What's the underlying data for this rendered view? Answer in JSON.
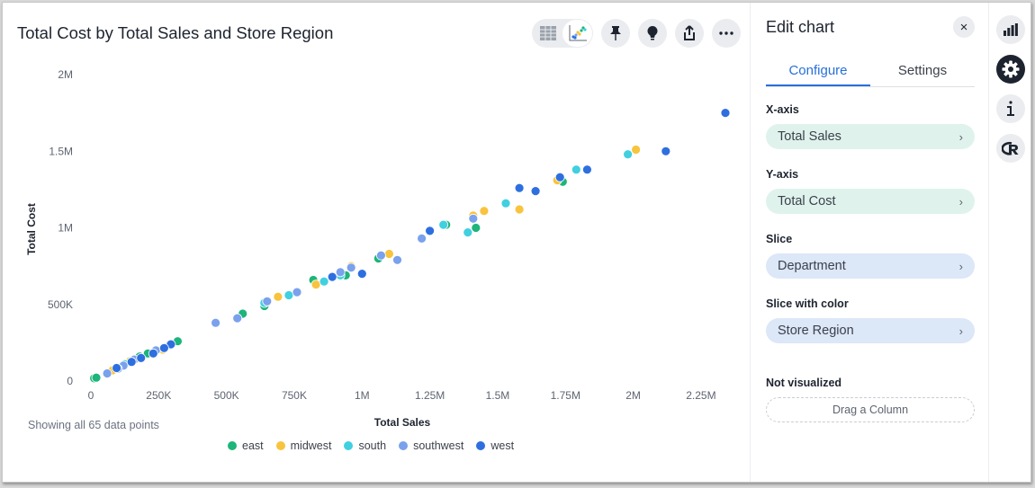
{
  "title": "Total Cost by Total Sales and Store Region",
  "toolbar": {
    "buttons": [
      {
        "name": "table-view-icon"
      },
      {
        "name": "chart-view-icon"
      },
      {
        "name": "pin-icon"
      },
      {
        "name": "lightbulb-icon"
      },
      {
        "name": "share-icon"
      },
      {
        "name": "more-icon"
      }
    ]
  },
  "footnote": "Showing all 65 data points",
  "panel": {
    "title": "Edit chart",
    "close_label": "×",
    "tabs": [
      {
        "label": "Configure",
        "active": true
      },
      {
        "label": "Settings",
        "active": false
      }
    ],
    "sections": [
      {
        "label": "X-axis",
        "value": "Total Sales",
        "color": "green"
      },
      {
        "label": "Y-axis",
        "value": "Total Cost",
        "color": "green"
      },
      {
        "label": "Slice",
        "value": "Department",
        "color": "blue"
      },
      {
        "label": "Slice with color",
        "value": "Store Region",
        "color": "blue"
      }
    ],
    "not_visualized_label": "Not visualized",
    "drop_placeholder": "Drag a Column",
    "chevron": "›"
  },
  "rail": {
    "buttons": [
      {
        "name": "chart-type-icon",
        "active": false
      },
      {
        "name": "settings-gear-icon",
        "active": true
      },
      {
        "name": "info-icon",
        "active": false
      },
      {
        "name": "r-language-icon",
        "active": false
      }
    ]
  },
  "chart_data": {
    "type": "scatter",
    "title": "Total Cost by Total Sales and Store Region",
    "xlabel": "Total Sales",
    "ylabel": "Total Cost",
    "xlim": [
      0,
      2400000
    ],
    "ylim": [
      0,
      2000000
    ],
    "xticks": [
      0,
      250000,
      500000,
      750000,
      1000000,
      1250000,
      1500000,
      1750000,
      2000000,
      2250000
    ],
    "xtick_labels": [
      "0",
      "250K",
      "500K",
      "750K",
      "1M",
      "1.25M",
      "1.5M",
      "1.75M",
      "2M",
      "2.25M"
    ],
    "yticks": [
      0,
      500000,
      1000000,
      1500000,
      2000000
    ],
    "ytick_labels": [
      "0",
      "500K",
      "1M",
      "1.5M",
      "2M"
    ],
    "grid": false,
    "legend": "bottom-center",
    "series": [
      {
        "name": "east",
        "color": "#1db57a",
        "points": [
          [
            12000,
            18000
          ],
          [
            20000,
            22000
          ],
          [
            180000,
            160000
          ],
          [
            320000,
            260000
          ],
          [
            560000,
            440000
          ],
          [
            640000,
            490000
          ],
          [
            820000,
            660000
          ],
          [
            1060000,
            800000
          ],
          [
            1310000,
            1020000
          ],
          [
            1420000,
            1000000
          ],
          [
            1740000,
            1300000
          ],
          [
            210000,
            180000
          ],
          [
            940000,
            690000
          ]
        ]
      },
      {
        "name": "midwest",
        "color": "#f8c43d",
        "points": [
          [
            80000,
            70000
          ],
          [
            145000,
            130000
          ],
          [
            265000,
            205000
          ],
          [
            690000,
            550000
          ],
          [
            830000,
            630000
          ],
          [
            960000,
            750000
          ],
          [
            1100000,
            830000
          ],
          [
            1410000,
            1080000
          ],
          [
            1450000,
            1110000
          ],
          [
            1580000,
            1120000
          ],
          [
            2010000,
            1510000
          ],
          [
            1720000,
            1310000
          ]
        ]
      },
      {
        "name": "south",
        "color": "#40d0e0",
        "points": [
          [
            640000,
            510000
          ],
          [
            730000,
            560000
          ],
          [
            920000,
            690000
          ],
          [
            1300000,
            1020000
          ],
          [
            1390000,
            970000
          ],
          [
            1530000,
            1160000
          ],
          [
            1790000,
            1380000
          ],
          [
            1980000,
            1480000
          ],
          [
            860000,
            650000
          ],
          [
            125000,
            110000
          ]
        ]
      },
      {
        "name": "southwest",
        "color": "#7aa1ec",
        "points": [
          [
            60000,
            50000
          ],
          [
            120000,
            100000
          ],
          [
            160000,
            140000
          ],
          [
            240000,
            200000
          ],
          [
            460000,
            380000
          ],
          [
            540000,
            410000
          ],
          [
            650000,
            520000
          ],
          [
            760000,
            580000
          ],
          [
            920000,
            710000
          ],
          [
            960000,
            740000
          ],
          [
            1070000,
            820000
          ],
          [
            1130000,
            790000
          ],
          [
            1220000,
            930000
          ],
          [
            1410000,
            1060000
          ],
          [
            100000,
            80000
          ]
        ]
      },
      {
        "name": "west",
        "color": "#2e6fe0",
        "points": [
          [
            95000,
            85000
          ],
          [
            185000,
            150000
          ],
          [
            230000,
            180000
          ],
          [
            295000,
            240000
          ],
          [
            890000,
            680000
          ],
          [
            1250000,
            980000
          ],
          [
            1580000,
            1260000
          ],
          [
            1640000,
            1240000
          ],
          [
            1730000,
            1330000
          ],
          [
            1830000,
            1380000
          ],
          [
            2120000,
            1500000
          ],
          [
            2340000,
            1750000
          ],
          [
            1000000,
            700000
          ],
          [
            150000,
            125000
          ],
          [
            270000,
            215000
          ]
        ]
      }
    ]
  }
}
